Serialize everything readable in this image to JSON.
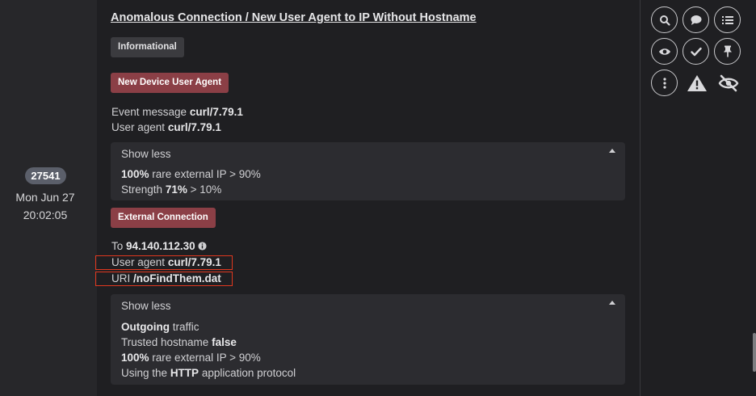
{
  "left": {
    "id_badge": "27541",
    "date": "Mon Jun 27",
    "time": "20:02:05"
  },
  "main": {
    "title": "Anomalous Connection / New User Agent to IP Without Hostname",
    "severity_chip": "Informational",
    "section1": {
      "chip": "New Device User Agent",
      "event_message_label": "Event message",
      "event_message_value": "curl/7.79.1",
      "user_agent_label": "User agent",
      "user_agent_value": "curl/7.79.1",
      "panel": {
        "toggle_label": "Show less",
        "line1_bold": "100%",
        "line1_rest": "rare external IP > 90%",
        "line2_label": "Strength",
        "line2_bold": "71%",
        "line2_rest": "> 10%"
      }
    },
    "section2": {
      "chip": "External Connection",
      "to_label": "To",
      "to_value": "94.140.112.30",
      "user_agent_label": "User agent",
      "user_agent_value": "curl/7.79.1",
      "uri_label": "URI",
      "uri_value": "/noFindThem.dat",
      "panel": {
        "toggle_label": "Show less",
        "line1_bold": "Outgoing",
        "line1_rest": "traffic",
        "line2_label": "Trusted hostname",
        "line2_bold": "false",
        "line3_bold": "100%",
        "line3_rest": "rare external IP > 90%",
        "line4_pre": "Using the",
        "line4_bold": "HTTP",
        "line4_rest": "application protocol"
      }
    }
  },
  "actions": {
    "icons": [
      "search-icon",
      "comment-icon",
      "list-icon",
      "eye-icon",
      "check-icon",
      "pin-icon",
      "more-icon",
      "warning-icon",
      "eye-slash-icon"
    ]
  },
  "colors": {
    "background": "#1f1f22",
    "left_column": "#27272a",
    "chip_red": "#8b3f46",
    "chip_gray": "#3b3b3f",
    "highlight": "#e0381f",
    "panel": "#2c2c30"
  }
}
